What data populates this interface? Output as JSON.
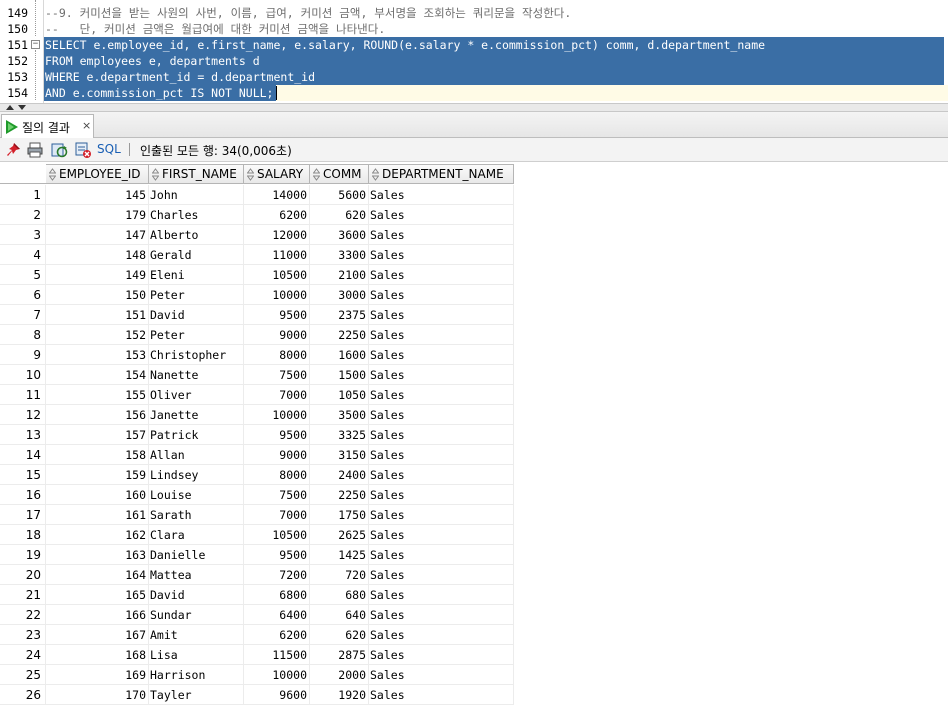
{
  "editor": {
    "lines": [
      {
        "num": "149",
        "text": "--9. 커미션을 받는 사원의 사번, 이름, 급여, 커미션 금액, 부서명을 조회하는 쿼리문을 작성한다.",
        "kind": "comment"
      },
      {
        "num": "150",
        "text": "--   단, 커미션 금액은 월급여에 대한 커미션 금액을 나타낸다.",
        "kind": "comment"
      },
      {
        "num": "151",
        "text": "SELECT e.employee_id, e.first_name, e.salary, ROUND(e.salary * e.commission_pct) comm, d.department_name",
        "kind": "selected"
      },
      {
        "num": "152",
        "text": "FROM employees e, departments d",
        "kind": "selected"
      },
      {
        "num": "153",
        "text": "WHERE e.department_id = d.department_id",
        "kind": "selected"
      },
      {
        "num": "154",
        "text": "AND e.commission_pct IS NOT NULL;",
        "kind": "selected"
      }
    ],
    "fold_symbol": "−"
  },
  "results_tab": {
    "label": "질의 결과",
    "close": "×"
  },
  "toolbar": {
    "sql_label": "SQL",
    "status": "인출된 모든 행: 34(0,006초)",
    "icons": [
      "pin-icon",
      "print-icon",
      "refresh-icon",
      "export-icon"
    ]
  },
  "grid": {
    "columns": [
      "EMPLOYEE_ID",
      "FIRST_NAME",
      "SALARY",
      "COMM",
      "DEPARTMENT_NAME"
    ],
    "rows": [
      [
        "1",
        "145",
        "John",
        "14000",
        "5600",
        "Sales"
      ],
      [
        "2",
        "179",
        "Charles",
        "6200",
        "620",
        "Sales"
      ],
      [
        "3",
        "147",
        "Alberto",
        "12000",
        "3600",
        "Sales"
      ],
      [
        "4",
        "148",
        "Gerald",
        "11000",
        "3300",
        "Sales"
      ],
      [
        "5",
        "149",
        "Eleni",
        "10500",
        "2100",
        "Sales"
      ],
      [
        "6",
        "150",
        "Peter",
        "10000",
        "3000",
        "Sales"
      ],
      [
        "7",
        "151",
        "David",
        "9500",
        "2375",
        "Sales"
      ],
      [
        "8",
        "152",
        "Peter",
        "9000",
        "2250",
        "Sales"
      ],
      [
        "9",
        "153",
        "Christopher",
        "8000",
        "1600",
        "Sales"
      ],
      [
        "10",
        "154",
        "Nanette",
        "7500",
        "1500",
        "Sales"
      ],
      [
        "11",
        "155",
        "Oliver",
        "7000",
        "1050",
        "Sales"
      ],
      [
        "12",
        "156",
        "Janette",
        "10000",
        "3500",
        "Sales"
      ],
      [
        "13",
        "157",
        "Patrick",
        "9500",
        "3325",
        "Sales"
      ],
      [
        "14",
        "158",
        "Allan",
        "9000",
        "3150",
        "Sales"
      ],
      [
        "15",
        "159",
        "Lindsey",
        "8000",
        "2400",
        "Sales"
      ],
      [
        "16",
        "160",
        "Louise",
        "7500",
        "2250",
        "Sales"
      ],
      [
        "17",
        "161",
        "Sarath",
        "7000",
        "1750",
        "Sales"
      ],
      [
        "18",
        "162",
        "Clara",
        "10500",
        "2625",
        "Sales"
      ],
      [
        "19",
        "163",
        "Danielle",
        "9500",
        "1425",
        "Sales"
      ],
      [
        "20",
        "164",
        "Mattea",
        "7200",
        "720",
        "Sales"
      ],
      [
        "21",
        "165",
        "David",
        "6800",
        "680",
        "Sales"
      ],
      [
        "22",
        "166",
        "Sundar",
        "6400",
        "640",
        "Sales"
      ],
      [
        "23",
        "167",
        "Amit",
        "6200",
        "620",
        "Sales"
      ],
      [
        "24",
        "168",
        "Lisa",
        "11500",
        "2875",
        "Sales"
      ],
      [
        "25",
        "169",
        "Harrison",
        "10000",
        "2000",
        "Sales"
      ],
      [
        "26",
        "170",
        "Tayler",
        "9600",
        "1920",
        "Sales"
      ]
    ]
  },
  "colors": {
    "selection": "#3a6ea5",
    "run_green": "#1f9a2a",
    "sql_link": "#1a5fb4"
  }
}
